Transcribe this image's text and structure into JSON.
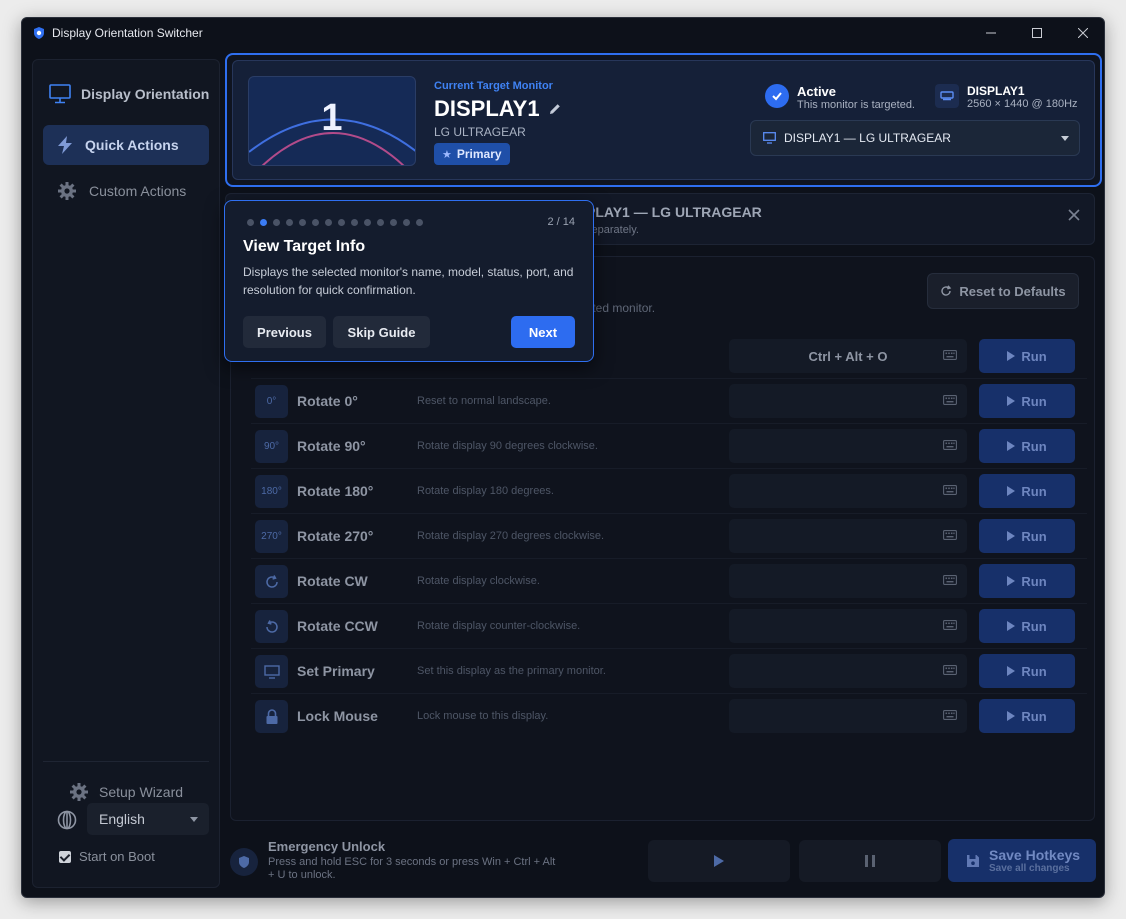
{
  "window": {
    "title": "Display Orientation Switcher"
  },
  "sidebar": {
    "header": "Display Orientation",
    "items": [
      {
        "label": "Quick Actions"
      },
      {
        "label": "Custom Actions"
      }
    ],
    "setup_wizard": "Setup Wizard",
    "language": "English",
    "start_on_boot": "Start on Boot"
  },
  "target": {
    "section_label": "Current Target Monitor",
    "name": "DISPLAY1",
    "model": "LG ULTRAGEAR",
    "preview_number": "1",
    "badge": "Primary",
    "status_title": "Active",
    "status_desc": "This monitor is targeted.",
    "port_name": "DISPLAY1",
    "port_desc": "2560 × 1440 @ 180Hz",
    "selector_value": "DISPLAY1 — LG ULTRAGEAR"
  },
  "banner": {
    "line1": "PLAY1 — LG ULTRAGEAR",
    "line2": "separately."
  },
  "main": {
    "reset_label": "Reset to Defaults",
    "desc_fragment": "lected monitor.",
    "run_label": "Run",
    "actions": [
      {
        "icon": "",
        "name": "",
        "desc": "",
        "hotkey": "Ctrl + Alt + O"
      },
      {
        "icon": "0°",
        "name": "Rotate 0°",
        "desc": "Reset to normal landscape.",
        "hotkey": ""
      },
      {
        "icon": "90°",
        "name": "Rotate 90°",
        "desc": "Rotate display 90 degrees clockwise.",
        "hotkey": ""
      },
      {
        "icon": "180°",
        "name": "Rotate 180°",
        "desc": "Rotate display 180 degrees.",
        "hotkey": ""
      },
      {
        "icon": "270°",
        "name": "Rotate 270°",
        "desc": "Rotate display 270 degrees clockwise.",
        "hotkey": ""
      },
      {
        "icon": "",
        "name": "Rotate CW",
        "desc": "Rotate display clockwise.",
        "hotkey": ""
      },
      {
        "icon": "",
        "name": "Rotate CCW",
        "desc": "Rotate display counter-clockwise.",
        "hotkey": ""
      },
      {
        "icon": "",
        "name": "Set Primary",
        "desc": "Set this display as the primary monitor.",
        "hotkey": ""
      },
      {
        "icon": "",
        "name": "Lock Mouse",
        "desc": "Lock mouse to this display.",
        "hotkey": ""
      }
    ]
  },
  "footer": {
    "emergency_title": "Emergency Unlock",
    "emergency_desc": "Press and hold ESC for 3 seconds or press Win + Ctrl + Alt + U to unlock.",
    "save_title": "Save Hotkeys",
    "save_sub": "Save all changes"
  },
  "guide": {
    "step": "2 / 14",
    "title": "View Target Info",
    "desc": "Displays the selected monitor's name, model, status, port, and resolution for quick confirmation.",
    "previous": "Previous",
    "skip": "Skip Guide",
    "next": "Next"
  },
  "colors": {
    "accent": "#2f6ff0",
    "background": "#0d111a",
    "active_nav": "#1d3057"
  }
}
